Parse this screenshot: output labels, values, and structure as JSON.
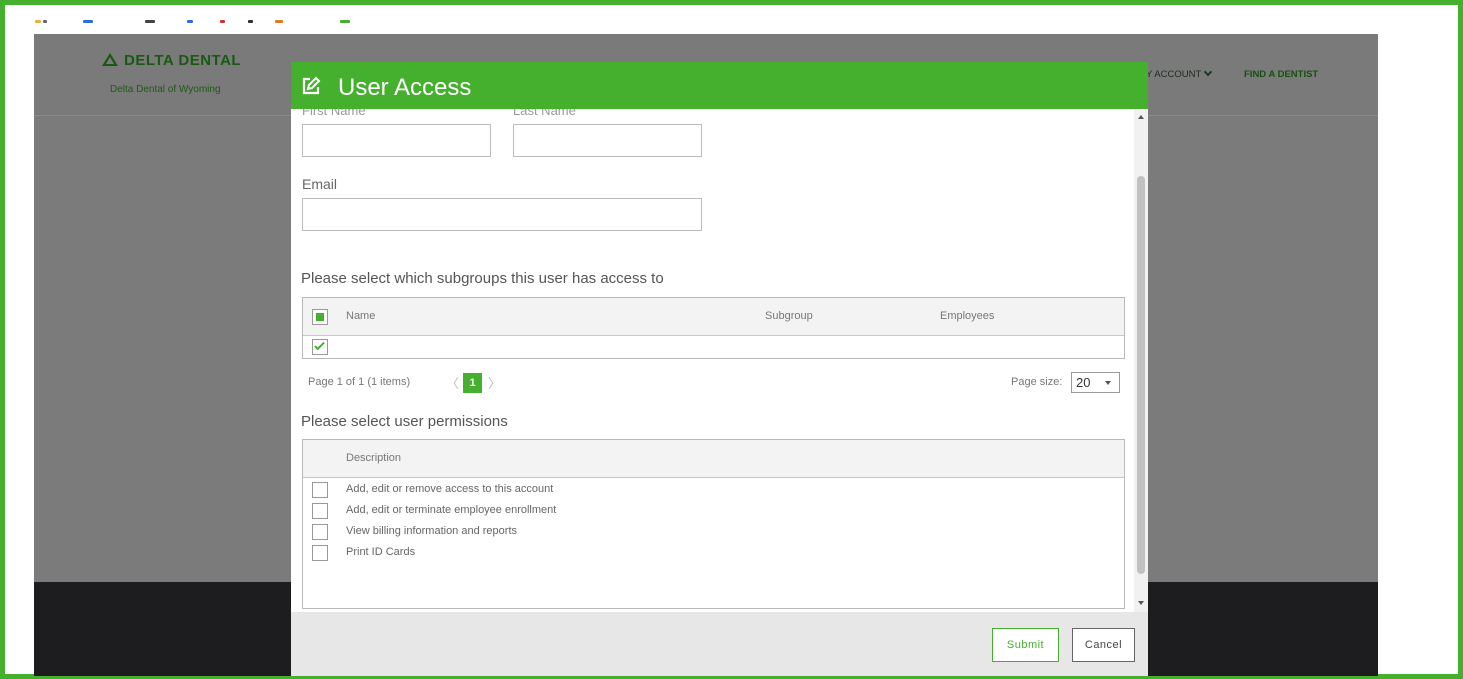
{
  "site": {
    "logo_text": "DELTA DENTAL",
    "logo_subtitle": "Delta Dental of Wyoming",
    "nav_account": "Y ACCOUNT",
    "nav_find": "FIND A DENTIST"
  },
  "modal": {
    "title": "User Access",
    "first_name_label": "First Name",
    "last_name_label": "Last Name",
    "email_label": "Email",
    "first_name_value": "",
    "last_name_value": "",
    "email_value": "",
    "subgroups_title": "Please select which subgroups this user has access to",
    "subgroups_grid": {
      "columns": [
        "Name",
        "Subgroup",
        "Employees"
      ],
      "rows": [
        {
          "name": "",
          "subgroup": "",
          "employees": "",
          "checked": true
        }
      ]
    },
    "pager": {
      "summary": "Page 1 of 1 (1 items)",
      "current_page": "1",
      "page_size_label": "Page size:",
      "page_size_value": "20"
    },
    "permissions_title": "Please select user permissions",
    "permissions_grid": {
      "column": "Description",
      "rows": [
        "Add, edit or remove access to this account",
        "Add, edit or terminate employee enrollment",
        "View billing information and reports",
        "Print ID Cards"
      ]
    },
    "submit_label": "Submit",
    "cancel_label": "Cancel"
  },
  "colors": {
    "brand_green": "#45b02e",
    "overlay": "#7b7b7b",
    "footer": "#1d1d1f"
  }
}
